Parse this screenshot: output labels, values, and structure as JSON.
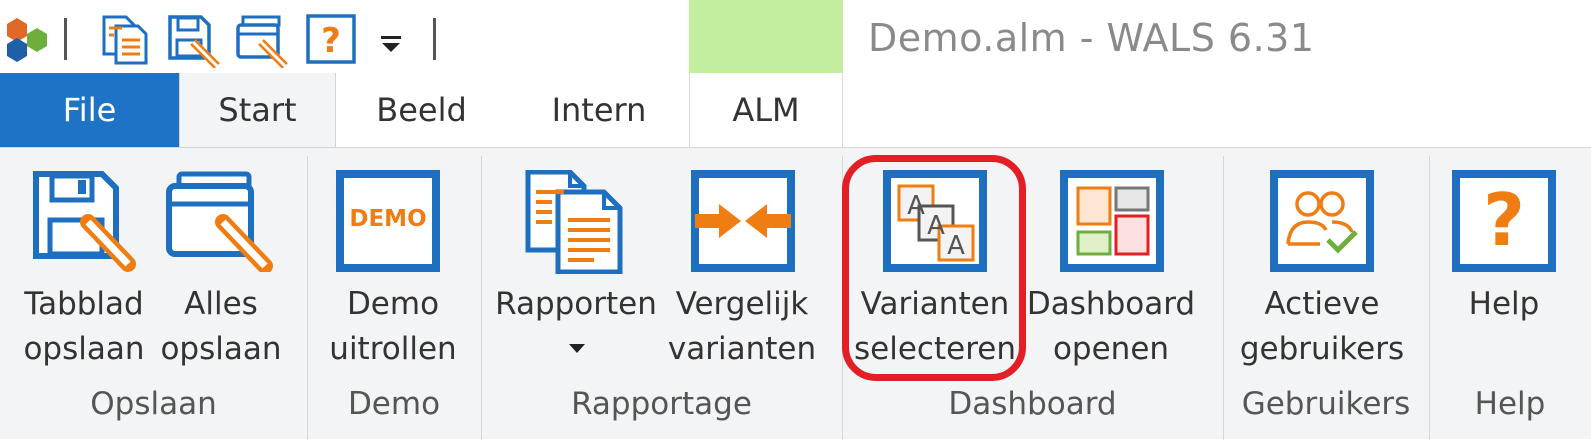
{
  "window": {
    "title": "Demo.alm - WALS 6.31"
  },
  "quick_access": [
    {
      "name": "app-logo-icon"
    },
    {
      "name": "report-copy-icon"
    },
    {
      "name": "save-tab-icon"
    },
    {
      "name": "save-all-icon"
    },
    {
      "name": "help-icon"
    },
    {
      "name": "customize-dropdown-icon"
    }
  ],
  "tabs": [
    {
      "label": "File"
    },
    {
      "label": "Start"
    },
    {
      "label": "Beeld"
    },
    {
      "label": "Intern"
    },
    {
      "label": "ALM"
    }
  ],
  "ribbon": {
    "groups": {
      "opslaan": "Opslaan",
      "demo": "Demo",
      "rapportage": "Rapportage",
      "dashboard": "Dashboard",
      "gebruikers": "Gebruikers",
      "help": "Help"
    },
    "buttons": {
      "tabblad_opslaan": {
        "line1": "Tabblad",
        "line2": "opslaan"
      },
      "alles_opslaan": {
        "line1": "Alles",
        "line2": "opslaan"
      },
      "demo_uitrollen": {
        "line1": "Demo",
        "line2": "uitrollen",
        "icon_text": "DEMO"
      },
      "rapporten": {
        "line1": "Rapporten"
      },
      "vergelijk_varianten": {
        "line1": "Vergelijk",
        "line2": "varianten"
      },
      "varianten_selecteren": {
        "line1": "Varianten",
        "line2": "selecteren",
        "icon_letters": [
          "A",
          "A",
          "A"
        ]
      },
      "dashboard_openen": {
        "line1": "Dashboard",
        "line2": "openen"
      },
      "actieve_gebruikers": {
        "line1": "Actieve",
        "line2": "gebruikers"
      },
      "help": {
        "line1": "Help",
        "icon_text": "?"
      }
    }
  },
  "colors": {
    "accent_blue": "#1f73c6",
    "icon_blue": "#1e6fbf",
    "icon_orange": "#f07d12",
    "alm_context": "#c3eea0",
    "highlight_red": "#e41e25"
  }
}
